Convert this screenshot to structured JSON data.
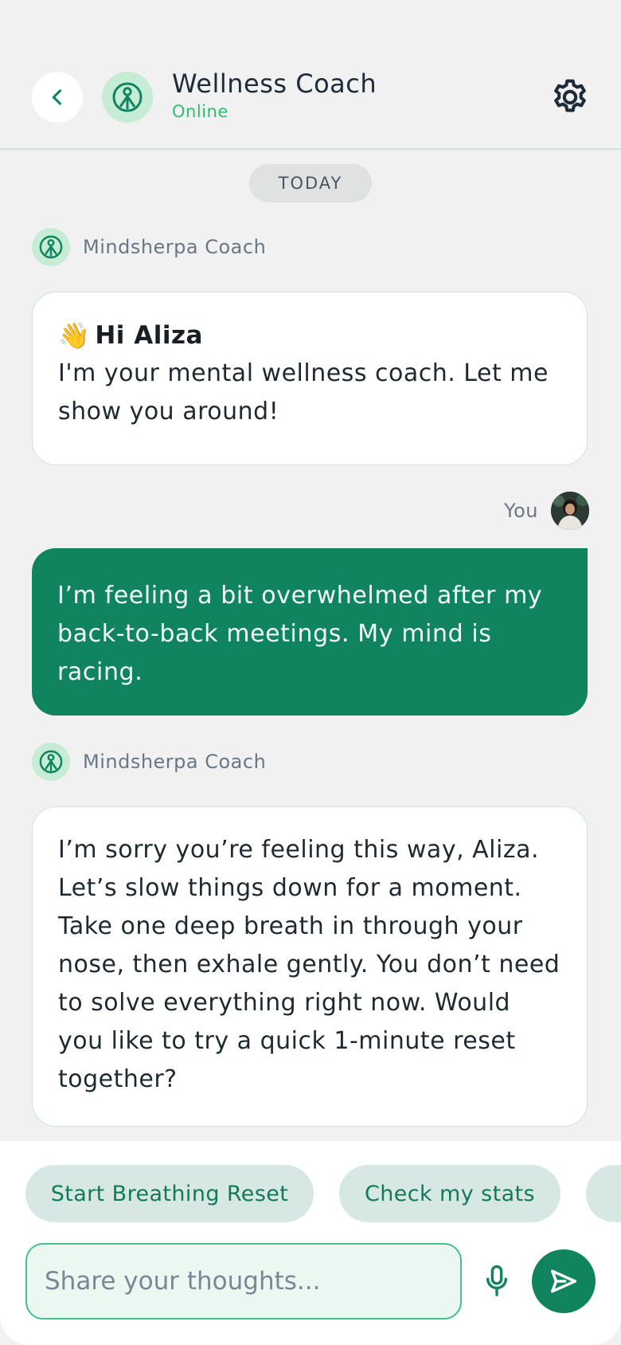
{
  "header": {
    "title": "Wellness Coach",
    "status": "Online",
    "back_icon": "chevron-left-icon",
    "avatar_icon": "coach-logo-icon",
    "settings_icon": "gear-icon"
  },
  "divider": {
    "label": "TODAY"
  },
  "messages": [
    {
      "sender": "Mindsherpa Coach",
      "greeting_emoji": "👋",
      "greeting": "Hi Aliza",
      "text": "I'm your mental wellness coach. Let me show you around!"
    },
    {
      "sender": "You",
      "text": "I’m feeling a bit overwhelmed after my back-to-back meetings. My mind is racing."
    },
    {
      "sender": "Mindsherpa Coach",
      "text": "I’m sorry you’re feeling this way, Aliza. Let’s slow things down for a moment. Take one deep breath in through your nose, then exhale gently. You don’t need to solve everything right now. Would you like to try a quick 1-minute reset together?"
    }
  ],
  "quick_replies": [
    {
      "label": "Start Breathing Reset"
    },
    {
      "label": "Check my stats"
    },
    {
      "label": ""
    }
  ],
  "composer": {
    "placeholder": "Share your thoughts...",
    "mic_icon": "microphone-icon",
    "send_icon": "send-icon"
  },
  "colors": {
    "brand_green": "#0f845e",
    "online_green": "#2fbf71",
    "background": "#f0f1f0"
  }
}
